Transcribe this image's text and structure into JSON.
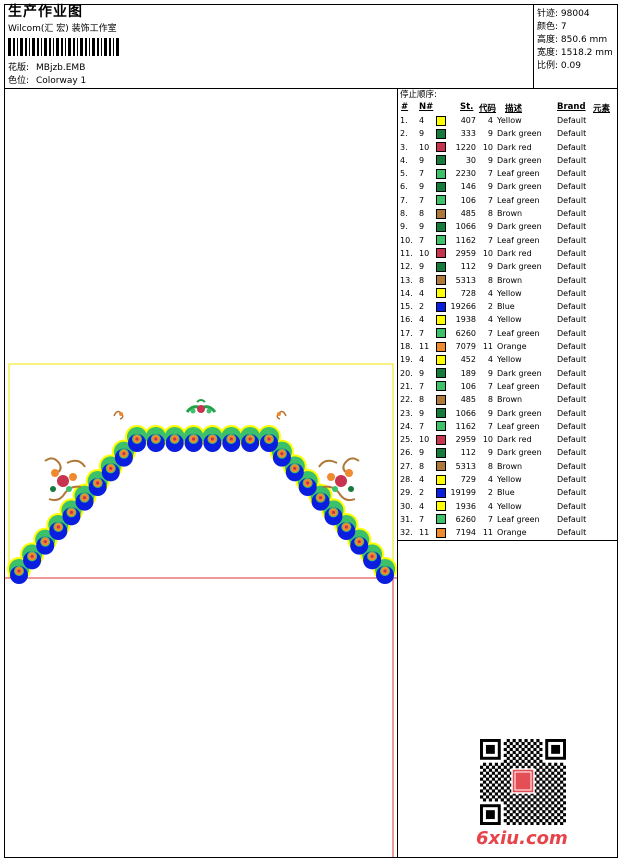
{
  "header": {
    "title": "生产作业图",
    "software": "Wilcom(汇 宏) 装饰工作室",
    "design_label": "花版:",
    "design_value": "MBjzb.EMB",
    "colorway_label": "色位:",
    "colorway_value": "Colorway 1"
  },
  "stats": [
    {
      "label": "针迹:",
      "value": "98004"
    },
    {
      "label": "颜色:",
      "value": "7"
    },
    {
      "label": "高度:",
      "value": "850.6 mm"
    },
    {
      "label": "宽度:",
      "value": "1518.2 mm"
    },
    {
      "label": "比例:",
      "value": "0.09"
    }
  ],
  "stop_sequence": {
    "title": "停止顺序:",
    "columns": [
      "#",
      "N#",
      "St.",
      "代码",
      "描述",
      "Brand",
      "元素"
    ],
    "rows": [
      {
        "idx": "1.",
        "n": "4",
        "color": "#ffff00",
        "st": "407",
        "code": "4",
        "desc": "Yellow",
        "brand": "Default"
      },
      {
        "idx": "2.",
        "n": "9",
        "color": "#157a3c",
        "st": "333",
        "code": "9",
        "desc": "Dark green",
        "brand": "Default"
      },
      {
        "idx": "3.",
        "n": "10",
        "color": "#c8334f",
        "st": "1220",
        "code": "10",
        "desc": "Dark red",
        "brand": "Default"
      },
      {
        "idx": "4.",
        "n": "9",
        "color": "#157a3c",
        "st": "30",
        "code": "9",
        "desc": "Dark green",
        "brand": "Default"
      },
      {
        "idx": "5.",
        "n": "7",
        "color": "#3cc06a",
        "st": "2230",
        "code": "7",
        "desc": "Leaf green",
        "brand": "Default"
      },
      {
        "idx": "6.",
        "n": "9",
        "color": "#157a3c",
        "st": "146",
        "code": "9",
        "desc": "Dark green",
        "brand": "Default"
      },
      {
        "idx": "7.",
        "n": "7",
        "color": "#3cc06a",
        "st": "106",
        "code": "7",
        "desc": "Leaf green",
        "brand": "Default"
      },
      {
        "idx": "8.",
        "n": "8",
        "color": "#b07838",
        "st": "485",
        "code": "8",
        "desc": "Brown",
        "brand": "Default"
      },
      {
        "idx": "9.",
        "n": "9",
        "color": "#157a3c",
        "st": "1066",
        "code": "9",
        "desc": "Dark green",
        "brand": "Default"
      },
      {
        "idx": "10.",
        "n": "7",
        "color": "#3cc06a",
        "st": "1162",
        "code": "7",
        "desc": "Leaf green",
        "brand": "Default"
      },
      {
        "idx": "11.",
        "n": "10",
        "color": "#c8334f",
        "st": "2959",
        "code": "10",
        "desc": "Dark red",
        "brand": "Default"
      },
      {
        "idx": "12.",
        "n": "9",
        "color": "#157a3c",
        "st": "112",
        "code": "9",
        "desc": "Dark green",
        "brand": "Default"
      },
      {
        "idx": "13.",
        "n": "8",
        "color": "#b07838",
        "st": "5313",
        "code": "8",
        "desc": "Brown",
        "brand": "Default"
      },
      {
        "idx": "14.",
        "n": "4",
        "color": "#ffff00",
        "st": "728",
        "code": "4",
        "desc": "Yellow",
        "brand": "Default"
      },
      {
        "idx": "15.",
        "n": "2",
        "color": "#0a1ee0",
        "st": "19266",
        "code": "2",
        "desc": "Blue",
        "brand": "Default"
      },
      {
        "idx": "16.",
        "n": "4",
        "color": "#ffff00",
        "st": "1938",
        "code": "4",
        "desc": "Yellow",
        "brand": "Default"
      },
      {
        "idx": "17.",
        "n": "7",
        "color": "#3cc06a",
        "st": "6260",
        "code": "7",
        "desc": "Leaf green",
        "brand": "Default"
      },
      {
        "idx": "18.",
        "n": "11",
        "color": "#f08a2e",
        "st": "7079",
        "code": "11",
        "desc": "Orange",
        "brand": "Default"
      },
      {
        "idx": "19.",
        "n": "4",
        "color": "#ffff00",
        "st": "452",
        "code": "4",
        "desc": "Yellow",
        "brand": "Default"
      },
      {
        "idx": "20.",
        "n": "9",
        "color": "#157a3c",
        "st": "189",
        "code": "9",
        "desc": "Dark green",
        "brand": "Default"
      },
      {
        "idx": "21.",
        "n": "7",
        "color": "#3cc06a",
        "st": "106",
        "code": "7",
        "desc": "Leaf green",
        "brand": "Default"
      },
      {
        "idx": "22.",
        "n": "8",
        "color": "#b07838",
        "st": "485",
        "code": "8",
        "desc": "Brown",
        "brand": "Default"
      },
      {
        "idx": "23.",
        "n": "9",
        "color": "#157a3c",
        "st": "1066",
        "code": "9",
        "desc": "Dark green",
        "brand": "Default"
      },
      {
        "idx": "24.",
        "n": "7",
        "color": "#3cc06a",
        "st": "1162",
        "code": "7",
        "desc": "Leaf green",
        "brand": "Default"
      },
      {
        "idx": "25.",
        "n": "10",
        "color": "#c8334f",
        "st": "2959",
        "code": "10",
        "desc": "Dark red",
        "brand": "Default"
      },
      {
        "idx": "26.",
        "n": "9",
        "color": "#157a3c",
        "st": "112",
        "code": "9",
        "desc": "Dark green",
        "brand": "Default"
      },
      {
        "idx": "27.",
        "n": "8",
        "color": "#b07838",
        "st": "5313",
        "code": "8",
        "desc": "Brown",
        "brand": "Default"
      },
      {
        "idx": "28.",
        "n": "4",
        "color": "#ffff00",
        "st": "729",
        "code": "4",
        "desc": "Yellow",
        "brand": "Default"
      },
      {
        "idx": "29.",
        "n": "2",
        "color": "#0a1ee0",
        "st": "19199",
        "code": "2",
        "desc": "Blue",
        "brand": "Default"
      },
      {
        "idx": "30.",
        "n": "4",
        "color": "#ffff00",
        "st": "1936",
        "code": "4",
        "desc": "Yellow",
        "brand": "Default"
      },
      {
        "idx": "31.",
        "n": "7",
        "color": "#3cc06a",
        "st": "6260",
        "code": "7",
        "desc": "Leaf green",
        "brand": "Default"
      },
      {
        "idx": "32.",
        "n": "11",
        "color": "#f08a2e",
        "st": "7194",
        "code": "11",
        "desc": "Orange",
        "brand": "Default"
      }
    ]
  },
  "watermark": "6xiu.com"
}
